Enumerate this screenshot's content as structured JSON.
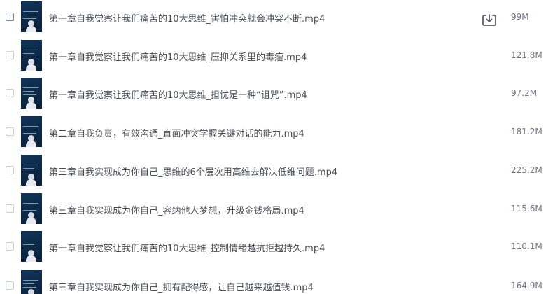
{
  "files": [
    {
      "name": "第一章自我觉察让我们痛苦的10大思维_害怕冲突就会冲突不断.mp4",
      "size": "99M"
    },
    {
      "name": "第一章自我觉察让我们痛苦的10大思维_压抑关系里的毒瘤.mp4",
      "size": "121.8M"
    },
    {
      "name": "第一章自我觉察让我们痛苦的10大思维_担忧是一种“诅咒”.mp4",
      "size": "97.2M"
    },
    {
      "name": "第二章自我负责，有效沟通_直面冲突学握关键对话的能力.mp4",
      "size": "181.2M"
    },
    {
      "name": "第三章自我实现成为你自己_思维的6个层次用高维去解决低维问题.mp4",
      "size": "225.2M"
    },
    {
      "name": "第三章自我实现成为你自己_容纳他人梦想，升级金钱格局.mp4",
      "size": "115.6M"
    },
    {
      "name": "第一章自我觉察让我们痛苦的10大思维_控制情绪越抗拒越持久.mp4",
      "size": "110.1M"
    },
    {
      "name": "第三章自我实现成为你自己_拥有配得感，让自己越来越值钱.mp4",
      "size": "164.9M"
    }
  ],
  "actions": {
    "download_icon": "download-icon"
  },
  "colors": {
    "thumbnail_bg": "#0d2a47",
    "text": "#4a4f57",
    "size_text": "#6d7380"
  }
}
